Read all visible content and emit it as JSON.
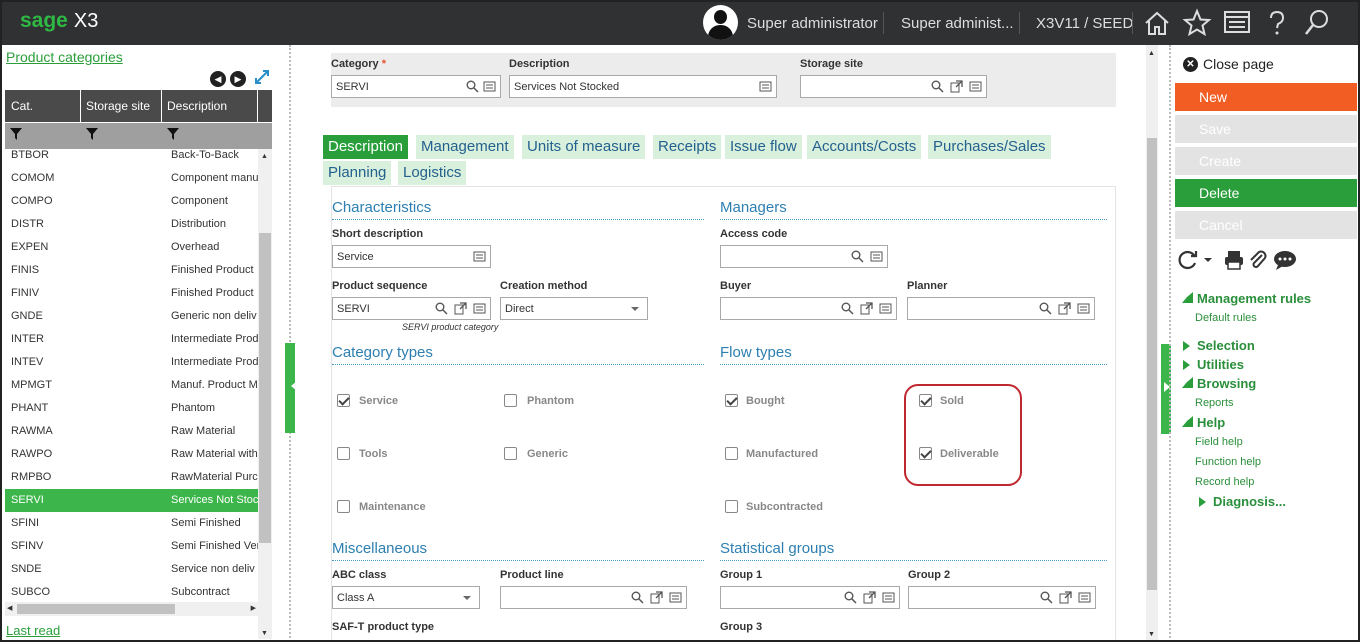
{
  "topbar": {
    "brand": "sage",
    "product": "X3",
    "user": "Super administrator",
    "role": "Super administ...",
    "folder": "X3V11 / SEED",
    "icons": [
      "home-icon",
      "star-icon",
      "screen-icon",
      "help-icon",
      "search-icon"
    ],
    "colors": {
      "bar": "#303133",
      "brand": "#2fb944"
    }
  },
  "left_panel": {
    "title": "Product categories",
    "columns": [
      "Cat.",
      "Storage site",
      "Description"
    ],
    "rows": [
      {
        "cat": "BTBOR",
        "site": "",
        "desc": "Back-To-Back"
      },
      {
        "cat": "COMOM",
        "site": "",
        "desc": "Component manu"
      },
      {
        "cat": "COMPO",
        "site": "",
        "desc": "Component"
      },
      {
        "cat": "DISTR",
        "site": "",
        "desc": "Distribution"
      },
      {
        "cat": "EXPEN",
        "site": "",
        "desc": "Overhead"
      },
      {
        "cat": "FINIS",
        "site": "",
        "desc": "Finished Product"
      },
      {
        "cat": "FINIV",
        "site": "",
        "desc": "Finished Product"
      },
      {
        "cat": "GNDE",
        "site": "",
        "desc": "Generic non deliv"
      },
      {
        "cat": "INTER",
        "site": "",
        "desc": "Intermediate Prod"
      },
      {
        "cat": "INTEV",
        "site": "",
        "desc": "Intermediate Prod"
      },
      {
        "cat": "MPMGT",
        "site": "",
        "desc": "Manuf. Product M"
      },
      {
        "cat": "PHANT",
        "site": "",
        "desc": "Phantom"
      },
      {
        "cat": "RAWMA",
        "site": "",
        "desc": "Raw Material"
      },
      {
        "cat": "RAWPO",
        "site": "",
        "desc": "Raw Material with"
      },
      {
        "cat": "RMPBO",
        "site": "",
        "desc": "RawMaterial Purc"
      },
      {
        "cat": "SERVI",
        "site": "",
        "desc": "Services Not Stoc"
      },
      {
        "cat": "SFINI",
        "site": "",
        "desc": "Semi Finished"
      },
      {
        "cat": "SFINV",
        "site": "",
        "desc": "Semi Finished Ver"
      },
      {
        "cat": "SNDE",
        "site": "",
        "desc": "Service non deliv"
      },
      {
        "cat": "SUBCO",
        "site": "",
        "desc": "Subcontract"
      }
    ],
    "selected": "SERVI",
    "last_read": "Last read"
  },
  "header": {
    "category_label": "Category",
    "category_value": "SERVI",
    "description_label": "Description",
    "description_value": "Services Not Stocked",
    "storage_label": "Storage site",
    "storage_value": ""
  },
  "tabs": [
    "Description",
    "Management",
    "Units of measure",
    "Receipts",
    "Issue flow",
    "Accounts/Costs",
    "Purchases/Sales",
    "Planning",
    "Logistics"
  ],
  "active_tab": "Description",
  "characteristics": {
    "title": "Characteristics",
    "short_desc_label": "Short description",
    "short_desc_value": "Service",
    "prod_seq_label": "Product sequence",
    "prod_seq_value": "SERVI",
    "prod_seq_note": "SERVI product category",
    "creation_label": "Creation method",
    "creation_value": "Direct"
  },
  "managers": {
    "title": "Managers",
    "access_label": "Access code",
    "access_value": "",
    "buyer_label": "Buyer",
    "buyer_value": "",
    "planner_label": "Planner",
    "planner_value": ""
  },
  "category_types": {
    "title": "Category types",
    "items": [
      {
        "label": "Service",
        "checked": true
      },
      {
        "label": "Phantom",
        "checked": false
      },
      {
        "label": "Tools",
        "checked": false
      },
      {
        "label": "Generic",
        "checked": false
      },
      {
        "label": "Maintenance",
        "checked": false
      }
    ]
  },
  "flow_types": {
    "title": "Flow types",
    "items": [
      {
        "label": "Bought",
        "checked": true
      },
      {
        "label": "Sold",
        "checked": true
      },
      {
        "label": "Manufactured",
        "checked": false
      },
      {
        "label": "Deliverable",
        "checked": true
      },
      {
        "label": "Subcontracted",
        "checked": false
      }
    ]
  },
  "misc": {
    "title": "Miscellaneous",
    "abc_label": "ABC class",
    "abc_value": "Class A",
    "line_label": "Product line",
    "line_value": "",
    "saft_label": "SAF-T product type"
  },
  "stat_groups": {
    "title": "Statistical groups",
    "g1_label": "Group 1",
    "g2_label": "Group 2",
    "g3_label": "Group 3"
  },
  "right_panel": {
    "close_label": "Close page",
    "new_label": "New",
    "save_label": "Save",
    "create_label": "Create",
    "delete_label": "Delete",
    "cancel_label": "Cancel",
    "management_rules": "Management rules",
    "default_rules": "Default rules",
    "selection": "Selection",
    "utilities": "Utilities",
    "browsing": "Browsing",
    "reports": "Reports",
    "help": "Help",
    "field_help": "Field help",
    "function_help": "Function help",
    "record_help": "Record help",
    "diagnosis": "Diagnosis...",
    "colors": {
      "new": "#f25d24",
      "delete": "#2a9e3b",
      "disabled": "#e3e3e3"
    }
  }
}
